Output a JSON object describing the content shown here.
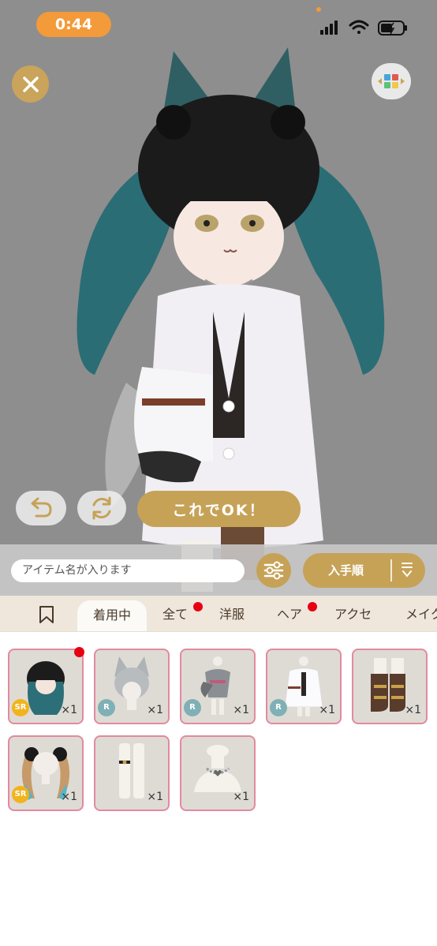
{
  "status": {
    "time": "0:44"
  },
  "preview": {
    "ok_label": "これでOK！"
  },
  "search": {
    "placeholder": "アイテム名が入ります",
    "sort_label": "入手順"
  },
  "tabs": [
    {
      "label": "着用中",
      "active": true
    },
    {
      "label": "全て",
      "badge": true
    },
    {
      "label": "洋服"
    },
    {
      "label": "ヘア",
      "badge": true
    },
    {
      "label": "アクセ"
    },
    {
      "label": "メイク"
    }
  ],
  "items": [
    {
      "name": "hair-twintail-black",
      "rarity": "SR",
      "count": "×1",
      "new": true
    },
    {
      "name": "wolf-ears",
      "rarity": "R",
      "count": "×1"
    },
    {
      "name": "wolf-tail",
      "rarity": "R",
      "count": "×1"
    },
    {
      "name": "white-coat",
      "rarity": "R",
      "count": "×1"
    },
    {
      "name": "brown-boots",
      "rarity": "",
      "count": "×1"
    },
    {
      "name": "pompom-hair-accessory",
      "rarity": "SR",
      "count": "×1"
    },
    {
      "name": "white-socks",
      "rarity": "",
      "count": "×1"
    },
    {
      "name": "heart-choker",
      "rarity": "",
      "count": "×1"
    }
  ],
  "colors": {
    "gold": "#c6a257",
    "sr": "#f2b31c",
    "r": "#7fb0b5",
    "badge": "#e60012"
  }
}
